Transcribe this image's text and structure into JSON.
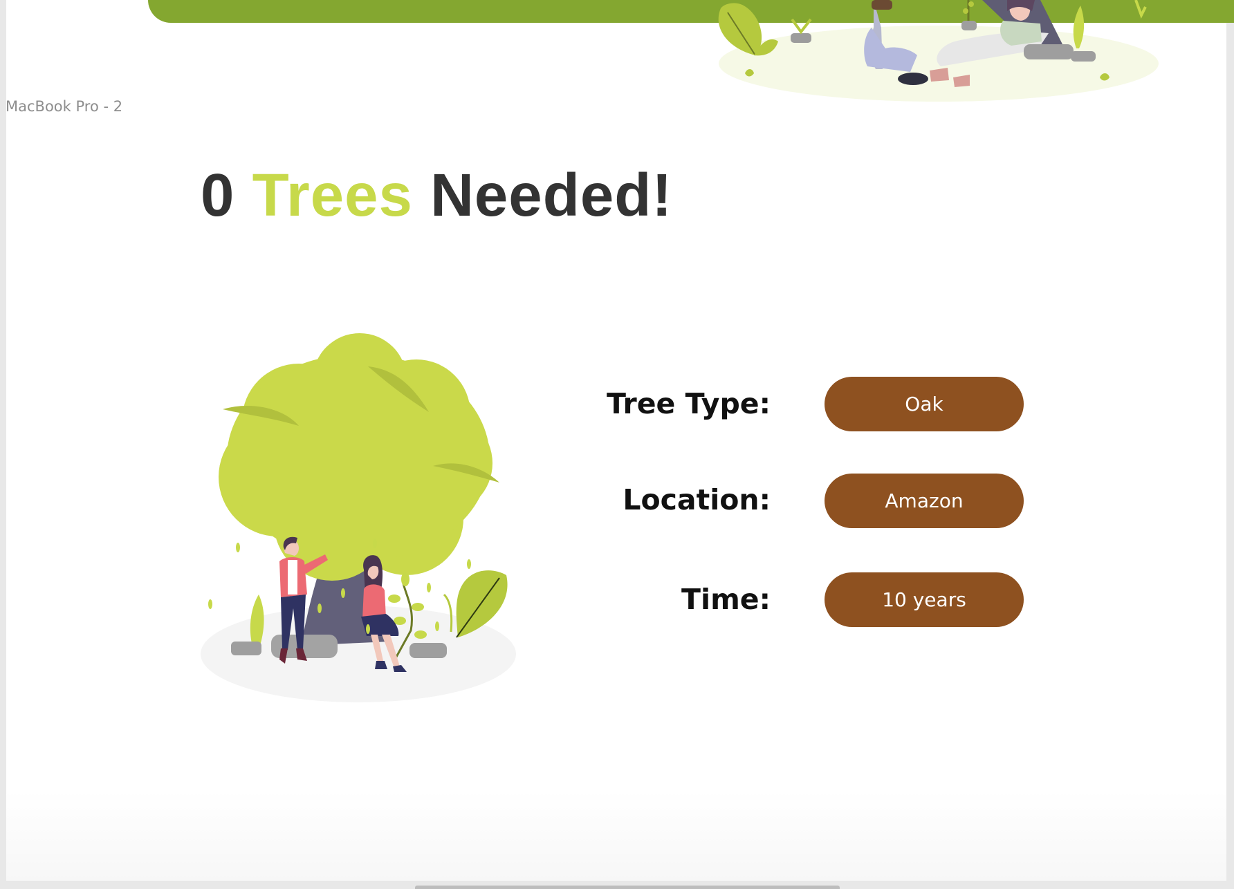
{
  "frame": {
    "label": "MacBook Pro - 2"
  },
  "headline": {
    "count": "0",
    "highlight": "Trees",
    "suffix": "Needed!"
  },
  "details": [
    {
      "label": "Tree Type:",
      "value": "Oak"
    },
    {
      "label": "Location:",
      "value": "Amazon"
    },
    {
      "label": "Time:",
      "value": "10 years"
    }
  ],
  "colors": {
    "banner": "#84a730",
    "accent": "#c7d94a",
    "pill": "#8e5120",
    "headline_text": "#333333"
  }
}
